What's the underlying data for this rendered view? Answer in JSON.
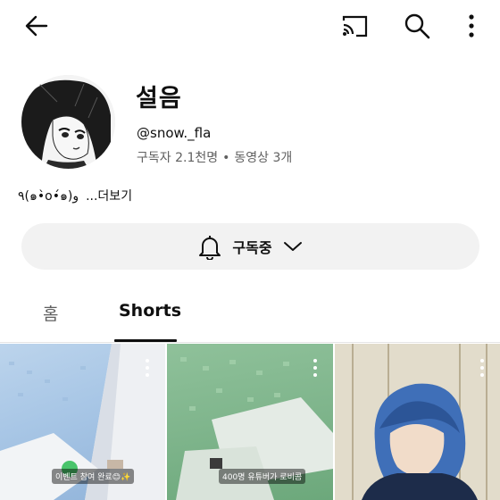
{
  "header": {
    "back_icon": "arrow-left-icon",
    "cast_icon": "cast-icon",
    "search_icon": "search-icon",
    "more_icon": "more-vertical-icon"
  },
  "channel": {
    "name": "설음",
    "handle": "@snow._fla",
    "subscribers": "구독자 2.1천명",
    "separator": "•",
    "videos": "동영상 3개",
    "description": "٩(๑•̀o•́๑)و",
    "more_label": "...더보기"
  },
  "subscribe": {
    "label": "구독중",
    "bell_icon": "bell-icon",
    "chevron_icon": "chevron-down-icon"
  },
  "tabs": [
    {
      "label": "홈",
      "selected": false
    },
    {
      "label": "Shorts",
      "selected": true
    }
  ],
  "shorts": [
    {
      "caption": "이벤트 참여 완료😊✨"
    },
    {
      "caption": "400명 유튜버가 로비콤"
    },
    {
      "caption": ""
    }
  ]
}
